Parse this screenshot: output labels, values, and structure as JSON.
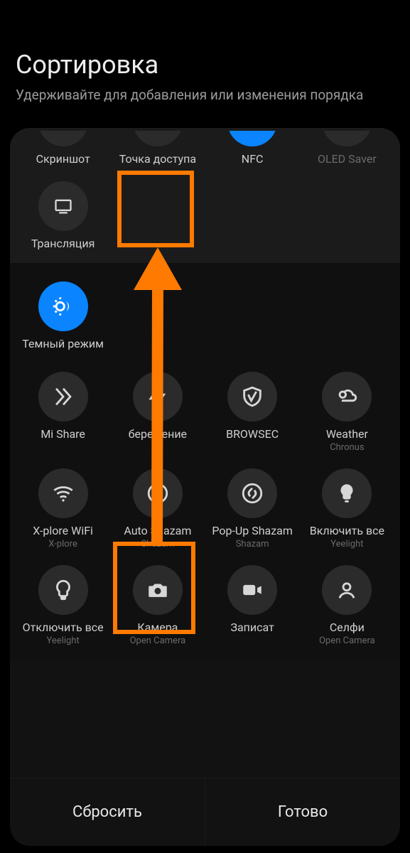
{
  "header": {
    "title": "Сортировка",
    "subtitle": "Удерживайте для добавления или изменения порядка"
  },
  "active_row": {
    "items": [
      {
        "label": "Скриншот",
        "icon": "cut-icon",
        "active": false,
        "disabled": false
      },
      {
        "label": "Точка доступа",
        "icon": "hotspot-icon",
        "active": false,
        "disabled": false
      },
      {
        "label": "NFC",
        "icon": "nfc-icon",
        "active": true,
        "disabled": false
      },
      {
        "label": "OLED Saver",
        "icon": "oled-icon",
        "active": false,
        "disabled": true
      }
    ],
    "items2": [
      {
        "label": "Трансляция",
        "icon": "cast-icon",
        "active": false
      }
    ]
  },
  "mid": {
    "items": [
      {
        "label": "Темный режим",
        "icon": "dark-mode-icon",
        "active": true
      }
    ]
  },
  "available": {
    "items": [
      {
        "label": "Mi Share",
        "sub": "",
        "icon": "mishare-icon"
      },
      {
        "label": "бережение",
        "sub": "",
        "icon": "bolt-icon"
      },
      {
        "label": "BROWSEC",
        "sub": "",
        "icon": "shield-icon"
      },
      {
        "label": "Weather",
        "sub": "Chronus",
        "icon": "weather-icon"
      },
      {
        "label": "X-plore WiFi",
        "sub": "X-plore",
        "icon": "wifi-icon"
      },
      {
        "label": "Auto Shazam",
        "sub": "Shazam",
        "icon": "shazam-icon"
      },
      {
        "label": "Pop-Up Shazam",
        "sub": "Shazam",
        "icon": "shazam-icon"
      },
      {
        "label": "Включить все",
        "sub": "Yeelight",
        "icon": "bulb-on-icon"
      },
      {
        "label": "Отключить все",
        "sub": "Yeelight",
        "icon": "bulb-off-icon"
      },
      {
        "label": "Камера",
        "sub": "Open Camera",
        "icon": "camera-icon"
      },
      {
        "label": "Записат",
        "sub": "",
        "icon": "video-icon"
      },
      {
        "label": "Селфи",
        "sub": "Open Camera",
        "icon": "selfie-icon"
      }
    ]
  },
  "footer": {
    "reset": "Сбросить",
    "done": "Готово"
  },
  "annotation": {
    "color": "#ff7a00"
  }
}
